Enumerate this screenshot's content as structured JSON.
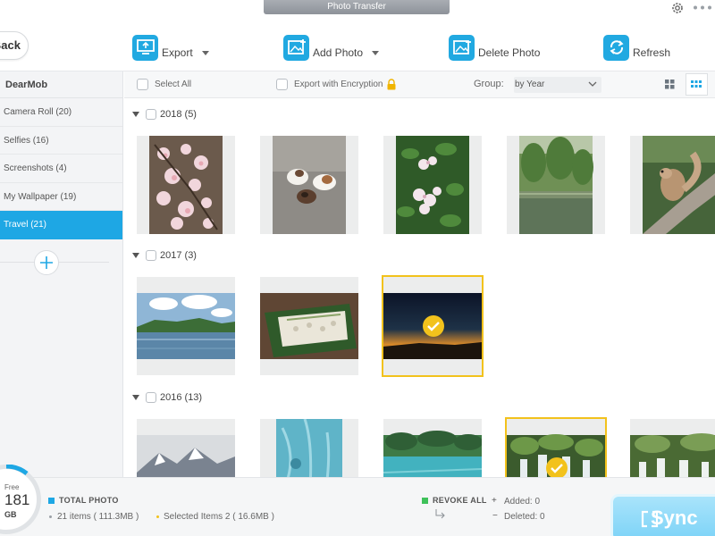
{
  "window": {
    "title": "Photo Transfer"
  },
  "toolbar": {
    "back_label": "Back",
    "export_label": "Export",
    "add_photo_label": "Add Photo",
    "delete_photo_label": "Delete Photo",
    "refresh_label": "Refresh"
  },
  "sidebar": {
    "header": "DearMob",
    "items": [
      {
        "label": "Camera Roll (20)"
      },
      {
        "label": "Selfies (16)"
      },
      {
        "label": "Screenshots (4)"
      },
      {
        "label": "My Wallpaper (19)"
      },
      {
        "label": "Travel (21)",
        "active": true
      }
    ]
  },
  "filter": {
    "select_all": "Select All",
    "export_encryption": "Export with Encryption",
    "group_label": "Group:",
    "group_value": "by Year"
  },
  "groups": [
    {
      "label": "2018 (5)"
    },
    {
      "label": "2017 (3)"
    },
    {
      "label": "2016 (13)"
    }
  ],
  "footer": {
    "storage_free_label": "Free",
    "storage_value": "181",
    "storage_unit": "GB",
    "total_photo_label": "TOTAL PHOTO",
    "items_text": "21 items ( 111.3MB )",
    "selected_text": "Selected Items 2 ( 16.6MB )",
    "revoke_all_label": "REVOKE ALL",
    "added_text": "Added: 0",
    "deleted_text": "Deleted: 0",
    "sync_label": "Sync"
  },
  "colors": {
    "accent": "#1ea7e4",
    "selection": "#f2c21c",
    "revoke": "#3fc15a",
    "sync": "#7dd3f7"
  },
  "icons": {
    "export": "export-icon",
    "add_photo": "add-photo-icon",
    "delete_photo": "delete-photo-icon",
    "refresh": "refresh-icon",
    "settings": "gear-icon"
  }
}
